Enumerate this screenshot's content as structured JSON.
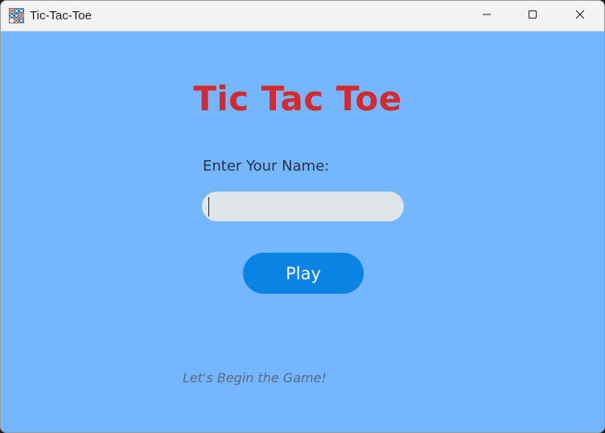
{
  "window": {
    "title": "Tic-Tac-Toe",
    "app_icon": "tic-tac-toe-grid-icon",
    "controls": {
      "minimize_icon": "minimize-icon",
      "maximize_icon": "maximize-icon",
      "close_icon": "close-icon"
    }
  },
  "main": {
    "heading": "Tic Tac Toe",
    "name_label": "Enter Your Name:",
    "name_input": {
      "value": "",
      "placeholder": ""
    },
    "play_label": "Play",
    "footer": "Let's Begin the Game!"
  },
  "colors": {
    "background": "#74b6ff",
    "heading": "#d4292d",
    "button": "#0a84e4",
    "input": "#dfe5e8",
    "titlebar": "#f3f3f3"
  }
}
